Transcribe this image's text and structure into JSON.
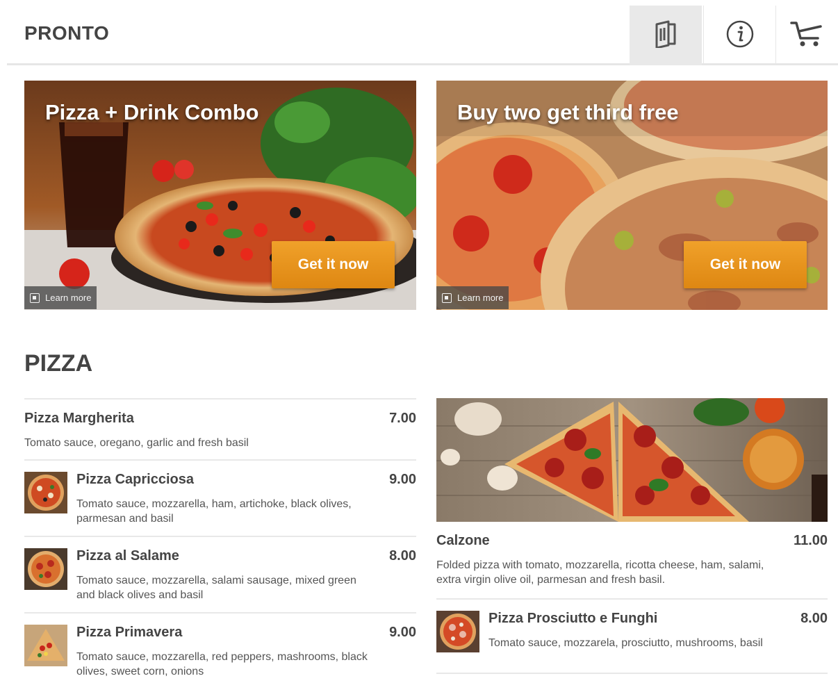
{
  "header": {
    "brand": "PRONTO",
    "buttons": [
      {
        "icon": "menu-book-icon"
      },
      {
        "icon": "info-icon"
      },
      {
        "icon": "cart-icon"
      }
    ]
  },
  "promos": [
    {
      "title": "Pizza + Drink Combo",
      "cta": "Get it now",
      "learn_more": "Learn more"
    },
    {
      "title": "Buy two get third free",
      "cta": "Get it now",
      "learn_more": "Learn more"
    }
  ],
  "section": {
    "title": "PIZZA"
  },
  "items": [
    {
      "name": "Pizza Margherita",
      "price": "7.00",
      "desc": "Tomato sauce, oregano, garlic and fresh basil"
    },
    {
      "name": "Pizza Capricciosa",
      "price": "9.00",
      "desc": "Tomato sauce, mozzarella, ham, artichoke, black olives, parmesan and basil"
    },
    {
      "name": "Pizza al Salame",
      "price": "8.00",
      "desc": "Tomato sauce, mozzarella, salami sausage, mixed green and black olives and basil"
    },
    {
      "name": "Pizza Primavera",
      "price": "9.00",
      "desc": "Tomato sauce, mozzarella, red peppers, mashrooms, black olives, sweet corn, onions"
    },
    {
      "name": "Calzone",
      "price": "11.00",
      "desc": "Folded pizza with tomato, mozzarella, ricotta cheese, ham, salami, extra virgin olive oil, parmesan and fresh basil."
    },
    {
      "name": "Pizza Prosciutto e Funghi",
      "price": "8.00",
      "desc": "Tomato sauce, mozzarela, prosciutto, mushrooms, basil"
    }
  ],
  "colors": {
    "accent": "#e8921c",
    "text": "#444444",
    "divider": "#e8e8e8"
  }
}
